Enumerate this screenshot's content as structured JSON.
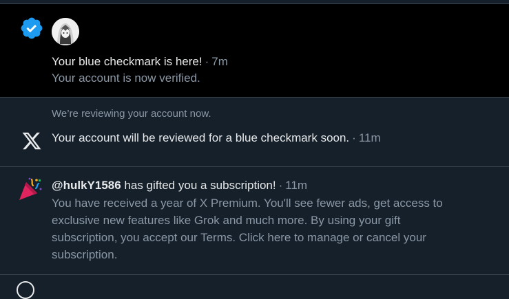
{
  "notifications": [
    {
      "icon": "verified-badge-icon",
      "avatar": "user-avatar",
      "title": "Your blue checkmark is here!",
      "time": "7m",
      "body": "Your account is now verified."
    },
    {
      "icon": "x-logo-icon",
      "pre_text": "We’re reviewing your account now.",
      "title": "Your account will be reviewed for a blue checkmark soon.",
      "time": "11m"
    },
    {
      "icon": "party-popper-icon",
      "user": "@hulkY1586",
      "title_rest": "has gifted you a subscription!",
      "time": "11m",
      "body_lines": [
        "You have received a year of X Premium. You'll see fewer ads, get access to",
        "exclusive new features like Grok and much more. By using your gift",
        "subscription, you accept our Terms. Click here to manage or cancel your",
        "subscription."
      ]
    }
  ],
  "colors": {
    "background": "#15202b",
    "highlight_background": "#000000",
    "primary_text": "#e7e9ea",
    "secondary_text": "#8b98a5",
    "verified_blue": "#1d9bf0",
    "divider": "#38444d"
  }
}
